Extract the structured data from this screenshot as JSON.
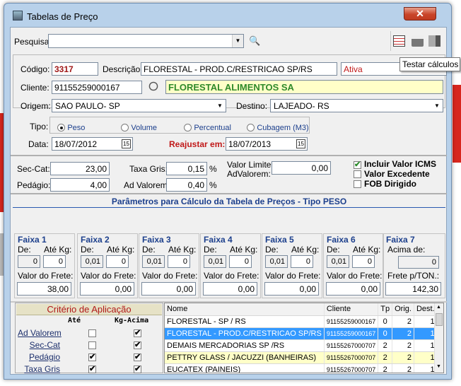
{
  "window": {
    "title": "Tabelas de Preço",
    "close": "✕"
  },
  "search": {
    "label": "Pesquisa:",
    "value": ""
  },
  "tooltip": "Testar cálculos",
  "form": {
    "codigo_label": "Código:",
    "codigo": "3317",
    "descricao_label": "Descrição:",
    "descricao": "FLORESTAL - PROD.C/RESTRICAO SP/RS",
    "status": "Ativa",
    "cliente_label": "Cliente:",
    "cliente": "91155259000167",
    "cliente_nome": "FLORESTAL ALIMENTOS SA",
    "origem_label": "Origem:",
    "origem": "SAO PAULO- SP",
    "destino_label": "Destino:",
    "destino": "LAJEADO- RS",
    "tipo_label": "Tipo:",
    "tipos": [
      "Peso",
      "Volume",
      "Percentual",
      "Cubagem (M3)"
    ],
    "data_label": "Data:",
    "data": "18/07/2012",
    "reajustar_label": "Reajustar em:",
    "reajustar": "18/07/2013"
  },
  "taxes": {
    "sec_cat_label": "Sec-Cat:",
    "sec_cat": "23,00",
    "pedagio_label": "Pedágio:",
    "pedagio": "4,00",
    "taxa_gris_label": "Taxa Gris:",
    "taxa_gris": "0,15",
    "ad_valorem_label": "Ad Valorem:",
    "ad_valorem": "0,40",
    "pct": "%",
    "valor_limite_label1": "Valor Limite",
    "valor_limite_label2": "AdValorem:",
    "valor_limite": "0,00",
    "incluir_icms": "Incluir Valor ICMS",
    "valor_excedente": "Valor Excedente",
    "fob": "FOB Dirigido"
  },
  "params_title": "Parâmetros para Cálculo da Tabela de Preços - Tipo PESO",
  "faixas": [
    {
      "title": "Faixa 1",
      "de": "0",
      "ate": "0",
      "frete": "38,00"
    },
    {
      "title": "Faixa 2",
      "de": "0,01",
      "ate": "0",
      "frete": "0,00"
    },
    {
      "title": "Faixa 3",
      "de": "0,01",
      "ate": "0",
      "frete": "0,00"
    },
    {
      "title": "Faixa 4",
      "de": "0,01",
      "ate": "0",
      "frete": "0,00"
    },
    {
      "title": "Faixa 5",
      "de": "0,01",
      "ate": "0",
      "frete": "0,00"
    },
    {
      "title": "Faixa 6",
      "de": "0,01",
      "ate": "0",
      "frete": "0,00"
    }
  ],
  "faixa_labels": {
    "de": "De:",
    "ate": "Até Kg:",
    "frete": "Valor do Frete:"
  },
  "faixa7": {
    "title": "Faixa 7",
    "acima_label": "Acima de:",
    "acima": "0",
    "frete_label": "Frete p/TON.:",
    "frete": "142,30"
  },
  "criterio": {
    "title": "Critério de Aplicação",
    "col_ate": "Até",
    "col_kg": "Kg-Acima",
    "rows": [
      {
        "label": "Ad Valorem",
        "ate": "",
        "kg": "✔"
      },
      {
        "label": "Sec-Cat",
        "ate": "",
        "kg": "✔"
      },
      {
        "label": "Pedágio",
        "ate": "✔",
        "kg": "✔"
      },
      {
        "label": "Taxa Gris",
        "ate": "✔",
        "kg": "✔"
      }
    ]
  },
  "table": {
    "headers": [
      "Nome",
      "Cliente",
      "Tp",
      "Orig.",
      "Dest."
    ],
    "rows": [
      {
        "nome": "FLORESTAL - SP / RS",
        "cliente": "91155259000167",
        "tp": "0",
        "orig": "2",
        "dest": "1"
      },
      {
        "nome": "FLORESTAL - PROD.C/RESTRICAO SP/RS",
        "cliente": "91155259000167",
        "tp": "0",
        "orig": "2",
        "dest": "1"
      },
      {
        "nome": "DEMAIS MERCADORIAS SP /RS",
        "cliente": "91155267000707",
        "tp": "2",
        "orig": "2",
        "dest": "1"
      },
      {
        "nome": "PETTRY GLASS / JACUZZI (BANHEIRAS)",
        "cliente": "91155267000707",
        "tp": "2",
        "orig": "2",
        "dest": "1"
      },
      {
        "nome": "EUCATEX (PAINEIS)",
        "cliente": "91155267000707",
        "tp": "2",
        "orig": "2",
        "dest": "1"
      }
    ]
  }
}
